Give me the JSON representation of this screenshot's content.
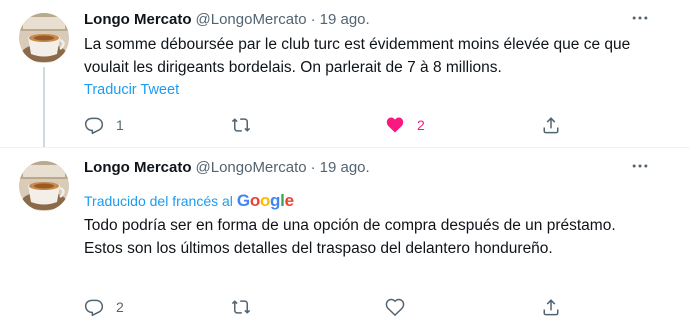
{
  "tweets": [
    {
      "name": "Longo Mercato",
      "handle": "@LongoMercato",
      "separator": "·",
      "time": "19 ago.",
      "text": "La somme déboursée par le club turc est évidemment moins élevée que ce que voulait les dirigeants bordelais. On parlerait de 7 à 8 millions.",
      "translate_link": "Traducir Tweet",
      "replies": "1",
      "retweets": "",
      "likes": "2",
      "liked": true
    },
    {
      "name": "Longo Mercato",
      "handle": "@LongoMercato",
      "separator": "·",
      "time": "19 ago.",
      "translated_by": "Traducido del francés al",
      "google": "Google",
      "text": "Todo podría ser en forma de una opción de compra después de un préstamo. Estos son los últimos detalles del traspaso del delantero hondureño.",
      "replies": "2",
      "retweets": "",
      "likes": "",
      "liked": false
    }
  ],
  "colors": {
    "accent": "#1d9bf0",
    "like": "#f91880",
    "muted": "#536471",
    "text": "#0f1419"
  },
  "icons": [
    "avatar",
    "more-icon",
    "reply-icon",
    "retweet-icon",
    "heart-icon",
    "share-icon"
  ]
}
